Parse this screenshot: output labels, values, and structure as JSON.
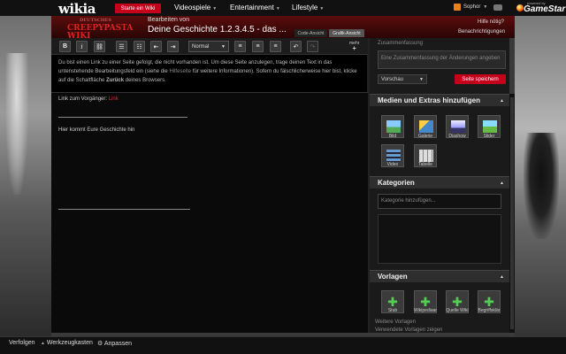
{
  "topbar": {
    "logo": "wikia",
    "start_wiki": "Starte ein Wiki",
    "nav": [
      "Videospiele",
      "Entertainment",
      "Lifestyle"
    ],
    "user": "Sophor",
    "gamestar_small": "powered by",
    "gamestar": "GameStar"
  },
  "header": {
    "wiki_name_small": "DEUTSCHES",
    "wiki_name": "CREEPYPASTA WIKI",
    "editing_label": "Bearbeiten von",
    "page_title": "Deine Geschichte 1.2.3.4.5 - das ...",
    "tab_code": "Code-Ansicht",
    "tab_visual": "Grafik-Ansicht",
    "help": "Hilfe nötig?",
    "notifications": "Benachrichtigungen"
  },
  "toolbar": {
    "format": "Normal",
    "more": "mehr"
  },
  "editor": {
    "notice_part1": "Du bist einen Link zu einer Seite gefolgt, die nicht vorhanden ist. Um diese Seite anzulegen, trage deinen Text in das untenstehende Bearbeitungsfeld ein (siehe die ",
    "notice_link": "Hilfeseite",
    "notice_part2": " für weitere Informationen). Sofern du fälschlicherweise hier bist, klicke auf die Schaltfläche ",
    "notice_bold": "Zurück",
    "notice_part3": " deines Browsers.",
    "line1_text": "Link zum Vorgänger: ",
    "line1_link": "Link",
    "line2_text": "Hier kommt Eure Geschichte hin"
  },
  "sidebar": {
    "summary_label": "Zusammenfassung",
    "summary_placeholder": "Eine Zusammenfassung der Änderungen angeben",
    "preview": "Vorschau",
    "save": "Seite speichern",
    "media_title": "Medien und Extras hinzufügen",
    "media_items": [
      "Bild",
      "Galerie",
      "Diashow",
      "Slider",
      "Video",
      "Tabelle"
    ],
    "categories_title": "Kategorien",
    "category_placeholder": "Kategorie hinzufügen...",
    "templates_title": "Vorlagen",
    "templates": [
      "Stub",
      "Wikipediaar",
      "Quelle Wiki",
      "Begriffsklär"
    ],
    "more_templates": "Weitere Vorlagen",
    "used_templates": "Verwendete Vorlagen zeigen"
  },
  "bottombar": {
    "follow": "Verfolgen",
    "toolbox": "Werkzeugkasten",
    "customize": "Anpassen"
  }
}
